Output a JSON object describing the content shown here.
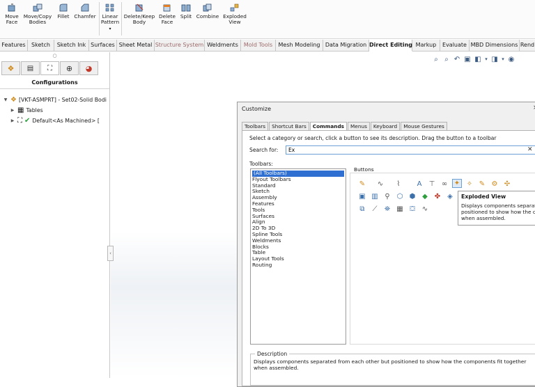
{
  "ribbon": {
    "buttons": [
      {
        "label": "Move\nFace",
        "icon": "move-face-icon"
      },
      {
        "label": "Move/Copy\nBodies",
        "icon": "move-copy-bodies-icon"
      },
      {
        "label": "Fillet",
        "icon": "fillet-icon"
      },
      {
        "label": "Chamfer",
        "icon": "chamfer-icon"
      },
      {
        "label": "Linear\nPattern",
        "icon": "linear-pattern-icon"
      },
      {
        "label": "Delete/Keep\nBody",
        "icon": "delete-keep-body-icon"
      },
      {
        "label": "Delete\nFace",
        "icon": "delete-face-icon"
      },
      {
        "label": "Split",
        "icon": "split-icon"
      },
      {
        "label": "Combine",
        "icon": "combine-icon"
      },
      {
        "label": "Exploded\nView",
        "icon": "exploded-view-icon"
      }
    ]
  },
  "tabs": [
    "Features",
    "Sketch",
    "Sketch Ink",
    "Surfaces",
    "Sheet Metal",
    "Structure System",
    "Weldments",
    "Mold Tools",
    "Mesh Modeling",
    "Data Migration",
    "Direct Editing",
    "Markup",
    "Evaluate",
    "MBD Dimensions",
    "Rend"
  ],
  "active_tab": "Direct Editing",
  "panel": {
    "title": "Configurations",
    "tree": {
      "root": "[VKT-ASMPRT] - Set02-Solid Bodi",
      "tables": "Tables",
      "config": "Default<As Machined> ["
    }
  },
  "dialog": {
    "title": "Customize",
    "close": "×",
    "tabs": [
      "Toolbars",
      "Shortcut Bars",
      "Commands",
      "Menus",
      "Keyboard",
      "Mouse Gestures"
    ],
    "active_tab": "Commands",
    "instruction": "Select a category or search, click a button to see its description. Drag the button to a toolbar",
    "search_label": "Search for:",
    "search_value": "Ex",
    "toolbars_label": "Toolbars:",
    "buttons_label": "Buttons",
    "toolbars": [
      "(All Toolbars)",
      "Flyout Toolbars",
      "Standard",
      "Sketch",
      "Assembly",
      "Features",
      "Tools",
      "Surfaces",
      "Align",
      "2D To 3D",
      "Spline Tools",
      "Weldments",
      "Blocks",
      "Table",
      "Layout Tools",
      "Routing"
    ],
    "selected_toolbar": "(All Toolbars)",
    "tooltip": {
      "title": "Exploded View",
      "text": "Displays components separat\npositioned to show how the c\nwhen assembled."
    },
    "description_label": "Description",
    "description": "Displays components separated from each other but positioned to show how the components fit together when assembled."
  },
  "colors": {
    "accent": "#2e6fd1",
    "tab_dim": "#9c6a6a",
    "highlight": "#dfeaf7"
  }
}
